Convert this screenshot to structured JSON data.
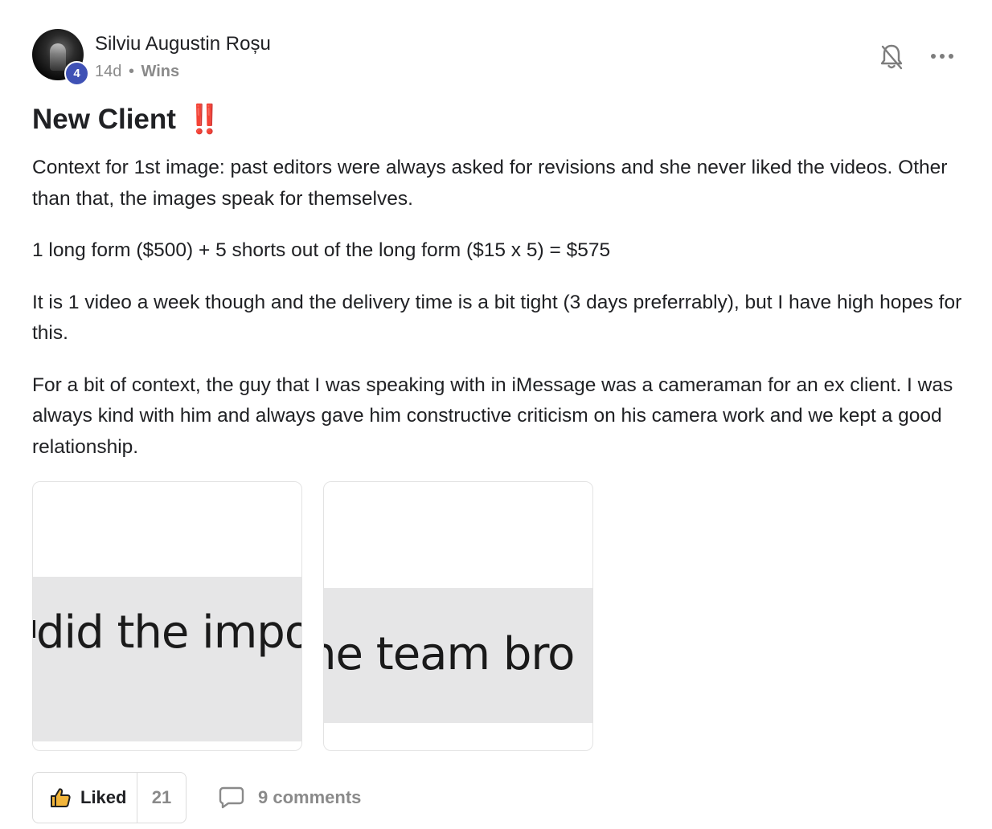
{
  "post": {
    "author": {
      "name": "Silviu Augustin Roșu",
      "level": "4"
    },
    "meta": {
      "age": "14d",
      "separator": "•",
      "category": "Wins"
    },
    "title": "New Client",
    "title_emoji": "‼️",
    "paragraphs": [
      "Context for 1st image: past editors were always asked for revisions and she never liked the videos. Other than that, the images speak for themselves.",
      "1 long form ($500) + 5 shorts out of the long form ($15 x 5) = $575",
      "It is 1 video a week though and the delivery time is a bit tight (3 days preferrably), but I have high hopes for this.",
      "For a bit of context, the guy that I was speaking with in iMessage was a cameraman for an ex client. I was always kind with him and always gave him constructive criticism on his camera work and we kept a good relationship."
    ],
    "images": [
      {
        "snippet": "did the impos"
      },
      {
        "snippet": "ne team bro"
      }
    ],
    "actions": {
      "like_label": "Liked",
      "like_count": "21",
      "comments_label": "9 comments",
      "bell_icon": "bell-off-icon",
      "more_icon": "more-horizontal-icon",
      "like_icon": "thumbs-up-icon",
      "comment_icon": "comment-icon"
    }
  },
  "colors": {
    "level_badge": "#3f51b5",
    "title_emoji": "#e8201f",
    "like_icon_fill": "#f2b53a",
    "muted_text": "#8a8a8a"
  }
}
